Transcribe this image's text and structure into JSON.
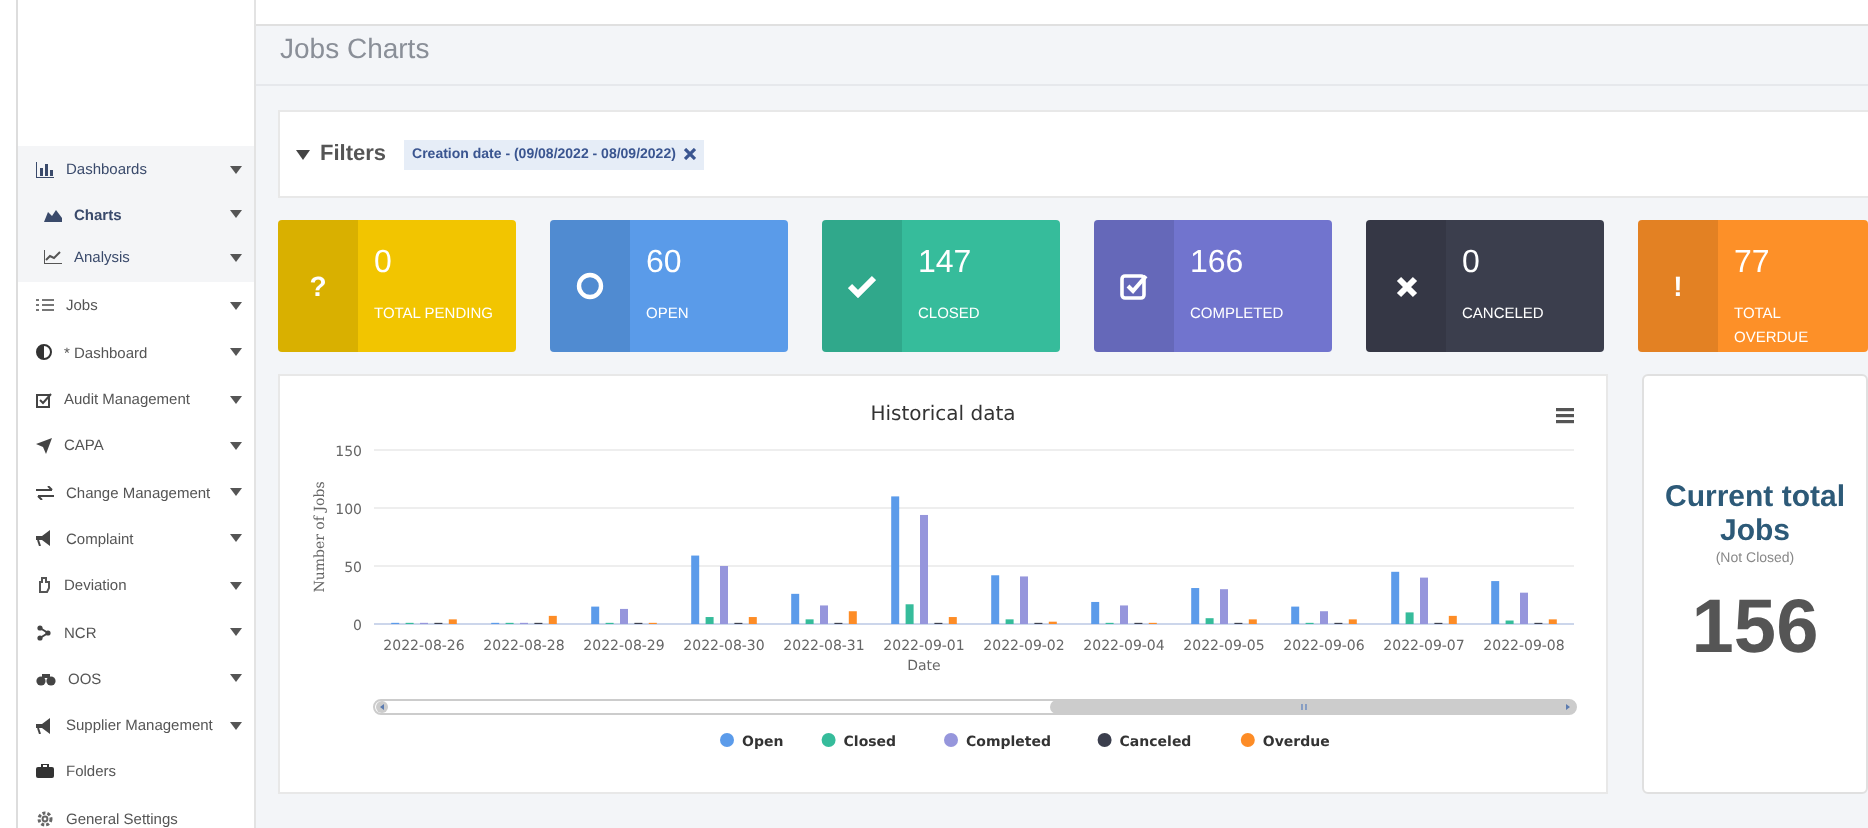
{
  "page_title": "Jobs Charts",
  "sidebar": {
    "items": [
      {
        "label": "Dashboards",
        "expandable": true,
        "expanded": true,
        "children": [
          {
            "label": "Charts",
            "expandable": true,
            "selected": true
          },
          {
            "label": "Analysis",
            "expandable": true,
            "selected": false
          }
        ]
      },
      {
        "label": "Jobs",
        "expandable": true,
        "expanded": false
      },
      {
        "label": "* Dashboard",
        "expandable": true,
        "expanded": false
      },
      {
        "label": "Audit Management",
        "expandable": true,
        "expanded": false
      },
      {
        "label": "CAPA",
        "expandable": true,
        "expanded": false
      },
      {
        "label": "Change Management",
        "expandable": true,
        "expanded": false
      },
      {
        "label": "Complaint",
        "expandable": true,
        "expanded": false
      },
      {
        "label": "Deviation",
        "expandable": true,
        "expanded": false
      },
      {
        "label": "NCR",
        "expandable": true,
        "expanded": false
      },
      {
        "label": "OOS",
        "expandable": true,
        "expanded": false
      },
      {
        "label": "Supplier Management",
        "expandable": true,
        "expanded": false
      },
      {
        "label": "Folders",
        "expandable": false,
        "expanded": false
      },
      {
        "label": "General Settings",
        "expandable": false,
        "expanded": false
      }
    ]
  },
  "filters": {
    "title": "Filters",
    "chips": [
      "Creation date - (09/08/2022 - 08/09/2022)"
    ]
  },
  "stat_cards": [
    {
      "kind": "pending",
      "icon": "?",
      "value": "0",
      "label": "TOTAL PENDING",
      "color": "#f2c500"
    },
    {
      "kind": "open",
      "value": "60",
      "label": "OPEN",
      "color": "#5a9be9"
    },
    {
      "kind": "closed",
      "value": "147",
      "label": "CLOSED",
      "color": "#36bc9b"
    },
    {
      "kind": "completed",
      "value": "166",
      "label": "COMPLETED",
      "color": "#7174ce"
    },
    {
      "kind": "canceled",
      "value": "0",
      "label": "CANCELED",
      "color": "#3b3e4d"
    },
    {
      "kind": "overdue",
      "icon": "!",
      "value": "77",
      "label": "TOTAL OVERDUE",
      "color": "#fd9028"
    }
  ],
  "chart": {
    "chart_data": {
      "type": "bar",
      "title": "Historical data",
      "xlabel": "Date",
      "ylabel": "Number of Jobs",
      "categories": [
        "2022-08-26",
        "2022-08-28",
        "2022-08-29",
        "2022-08-30",
        "2022-08-31",
        "2022-09-01",
        "2022-09-02",
        "2022-09-04",
        "2022-09-05",
        "2022-09-06",
        "2022-09-07",
        "2022-09-08"
      ],
      "series": [
        {
          "name": "Open",
          "color": "#5b9bea",
          "values": [
            1,
            1,
            15,
            59,
            26,
            110,
            42,
            19,
            31,
            15,
            45,
            37
          ]
        },
        {
          "name": "Closed",
          "color": "#36bc9b",
          "values": [
            1,
            1,
            1,
            6,
            4,
            17,
            4,
            1,
            5,
            1,
            10,
            3
          ]
        },
        {
          "name": "Completed",
          "color": "#9696dc",
          "values": [
            1,
            1,
            13,
            50,
            16,
            94,
            41,
            16,
            30,
            11,
            40,
            27
          ]
        },
        {
          "name": "Canceled",
          "color": "#3b3e4d",
          "values": [
            1,
            1,
            1,
            1,
            1,
            1,
            1,
            1,
            1,
            1,
            1,
            1
          ]
        },
        {
          "name": "Overdue",
          "color": "#fd8c26",
          "values": [
            4,
            7,
            1,
            6,
            11,
            6,
            2,
            1,
            4,
            4,
            7,
            4
          ]
        }
      ],
      "ylim": [
        0,
        150
      ],
      "yticks": [
        0,
        50,
        100,
        150
      ],
      "legend": true
    }
  },
  "total_panel": {
    "title": "Current total Jobs",
    "subtitle": "(Not Closed)",
    "value": "156"
  }
}
